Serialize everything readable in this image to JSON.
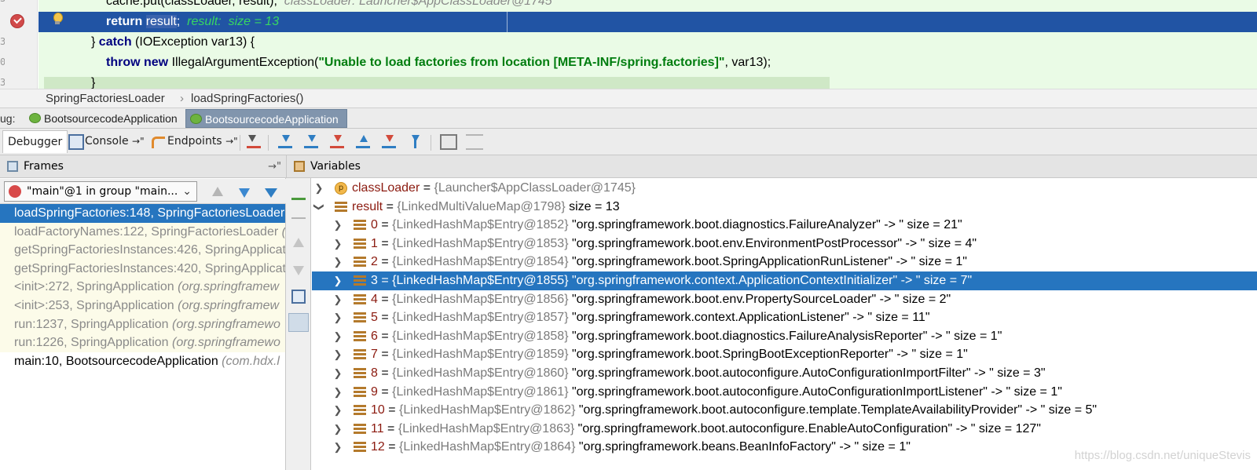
{
  "editor": {
    "line_prev_text": "cache.put(classLoader, result);",
    "line_prev_hint": "classLoader: Launcher$AppClassLoader@1745",
    "return_kw": "return",
    "return_var": "result",
    "return_semicolon": ";",
    "return_hint": "result:  size = 13",
    "catch_open": "} ",
    "catch_kw": "catch",
    "catch_rest": " (IOException var13) {",
    "throw_kw": "throw",
    "new_kw": "new",
    "throw_class": " IllegalArgumentException(",
    "throw_string": "\"Unable to load factories from location [META-INF/spring.factories]\"",
    "throw_rest": ", var13);",
    "close_brace": "}",
    "gutter_digits": [
      "3",
      "3",
      "0",
      "3"
    ]
  },
  "breadcrumb": {
    "class_name": "SpringFactoriesLoader",
    "separator": "›",
    "method_name": "loadSpringFactories()"
  },
  "debug_tabs": {
    "label": "ug:",
    "tabs": [
      "BootsourcecodeApplication",
      "BootsourcecodeApplication"
    ]
  },
  "toolbar": {
    "debugger": "Debugger",
    "console": "Console",
    "console_arrow": "→\"",
    "endpoints": "Endpoints",
    "endpoints_arrow": "→\""
  },
  "frames": {
    "header": "Frames",
    "pin": "→\"",
    "thread": "\"main\"@1 in group \"main...",
    "items": [
      {
        "method": "loadSpringFactories:148, SpringFactoriesLoader",
        "pkg": ""
      },
      {
        "method": "loadFactoryNames:122, SpringFactoriesLoader ",
        "pkg": "("
      },
      {
        "method": "getSpringFactoriesInstances:426, SpringApplicat",
        "pkg": ""
      },
      {
        "method": "getSpringFactoriesInstances:420, SpringApplicat",
        "pkg": ""
      },
      {
        "method": "<init>:272, SpringApplication ",
        "pkg": "(org.springframew"
      },
      {
        "method": "<init>:253, SpringApplication ",
        "pkg": "(org.springframew"
      },
      {
        "method": "run:1237, SpringApplication ",
        "pkg": "(org.springframewo"
      },
      {
        "method": "run:1226, SpringApplication ",
        "pkg": "(org.springframewo"
      },
      {
        "method": "main:10, BootsourcecodeApplication ",
        "pkg": "(com.hdx.l"
      }
    ]
  },
  "variables": {
    "header": "Variables",
    "rows": [
      {
        "name": "classLoader",
        "eq": " = ",
        "ref": "{Launcher$AppClassLoader@1745}",
        "val": ""
      },
      {
        "name": "result",
        "eq": " = ",
        "ref": "{LinkedMultiValueMap@1798}",
        "val": "  size = 13"
      },
      {
        "name": "0",
        "eq": " = ",
        "ref": "{LinkedHashMap$Entry@1852}",
        "val": " \"org.springframework.boot.diagnostics.FailureAnalyzer\" -> \" size = 21\""
      },
      {
        "name": "1",
        "eq": " = ",
        "ref": "{LinkedHashMap$Entry@1853}",
        "val": " \"org.springframework.boot.env.EnvironmentPostProcessor\" -> \" size = 4\""
      },
      {
        "name": "2",
        "eq": " = ",
        "ref": "{LinkedHashMap$Entry@1854}",
        "val": " \"org.springframework.boot.SpringApplicationRunListener\" -> \" size = 1\""
      },
      {
        "name": "3",
        "eq": " = ",
        "ref": "{LinkedHashMap$Entry@1855}",
        "val": " \"org.springframework.context.ApplicationContextInitializer\" -> \" size = 7\""
      },
      {
        "name": "4",
        "eq": " = ",
        "ref": "{LinkedHashMap$Entry@1856}",
        "val": " \"org.springframework.boot.env.PropertySourceLoader\" -> \" size = 2\""
      },
      {
        "name": "5",
        "eq": " = ",
        "ref": "{LinkedHashMap$Entry@1857}",
        "val": " \"org.springframework.context.ApplicationListener\" -> \" size = 11\""
      },
      {
        "name": "6",
        "eq": " = ",
        "ref": "{LinkedHashMap$Entry@1858}",
        "val": " \"org.springframework.boot.diagnostics.FailureAnalysisReporter\" -> \" size = 1\""
      },
      {
        "name": "7",
        "eq": " = ",
        "ref": "{LinkedHashMap$Entry@1859}",
        "val": " \"org.springframework.boot.SpringBootExceptionReporter\" -> \" size = 1\""
      },
      {
        "name": "8",
        "eq": " = ",
        "ref": "{LinkedHashMap$Entry@1860}",
        "val": " \"org.springframework.boot.autoconfigure.AutoConfigurationImportFilter\" -> \" size = 3\""
      },
      {
        "name": "9",
        "eq": " = ",
        "ref": "{LinkedHashMap$Entry@1861}",
        "val": " \"org.springframework.boot.autoconfigure.AutoConfigurationImportListener\" -> \" size = 1\""
      },
      {
        "name": "10",
        "eq": " = ",
        "ref": "{LinkedHashMap$Entry@1862}",
        "val": " \"org.springframework.boot.autoconfigure.template.TemplateAvailabilityProvider\" -> \" size = 5\""
      },
      {
        "name": "11",
        "eq": " = ",
        "ref": "{LinkedHashMap$Entry@1863}",
        "val": " \"org.springframework.boot.autoconfigure.EnableAutoConfiguration\" -> \" size = 127\""
      },
      {
        "name": "12",
        "eq": " = ",
        "ref": "{LinkedHashMap$Entry@1864}",
        "val": " \"org.springframework.beans.BeanInfoFactory\" -> \" size = 1\""
      }
    ]
  },
  "watermark": "https://blog.csdn.net/uniqueStevis"
}
